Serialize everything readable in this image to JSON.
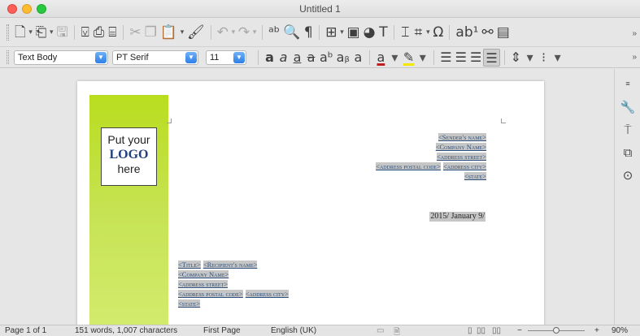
{
  "window": {
    "title": "Untitled 1"
  },
  "toolbar_standard": {
    "icons": [
      "new-icon",
      "dropdown-arrow",
      "template-icon",
      "dropdown-arrow",
      "save-icon",
      "export-pdf-icon",
      "print-icon",
      "print-preview-icon",
      "cut-icon",
      "copy-icon",
      "paste-icon",
      "dropdown-arrow",
      "clone-formatting-icon",
      "undo-icon",
      "dropdown-arrow",
      "redo-icon",
      "dropdown-arrow",
      "spellcheck-icon",
      "find-replace-icon",
      "formatting-marks-icon",
      "table-icon",
      "dropdown-arrow",
      "image-icon",
      "chart-icon",
      "textbox-icon",
      "page-break-icon",
      "field-icon",
      "dropdown-arrow",
      "special-character-icon",
      "footnote-icon",
      "comment-icon",
      "track-changes-icon",
      "more-icon"
    ]
  },
  "toolbar_format": {
    "paragraph_style": "Text Body",
    "font_name": "PT Serif",
    "font_size": "11",
    "font_color": "#c02020",
    "highlight_color": "#f3e600"
  },
  "document": {
    "logo": {
      "line1": "Put your",
      "line2": "LOGO",
      "line3": "here"
    },
    "sender": [
      "<Sender's name>",
      "<Company Name>",
      "<address street>"
    ],
    "sender_city_line": [
      "<address postal code>",
      "<address city>"
    ],
    "sender_state": "<state>",
    "date": "2015/ January 9/",
    "recipient_name_line": [
      "<Title>",
      "<Recipient's name>"
    ],
    "recipient_company": "<Company Name>",
    "recipient_street": "<address street>",
    "recipient_city_line": [
      "<address postal code>",
      "<address city>"
    ],
    "recipient_state": "<state>"
  },
  "statusbar": {
    "page": "Page 1 of 1",
    "words": "151 words, 1,007 characters",
    "page_style": "First Page",
    "language": "English (UK)",
    "zoom_minus": "−",
    "zoom_plus": "+",
    "zoom": "90%"
  }
}
